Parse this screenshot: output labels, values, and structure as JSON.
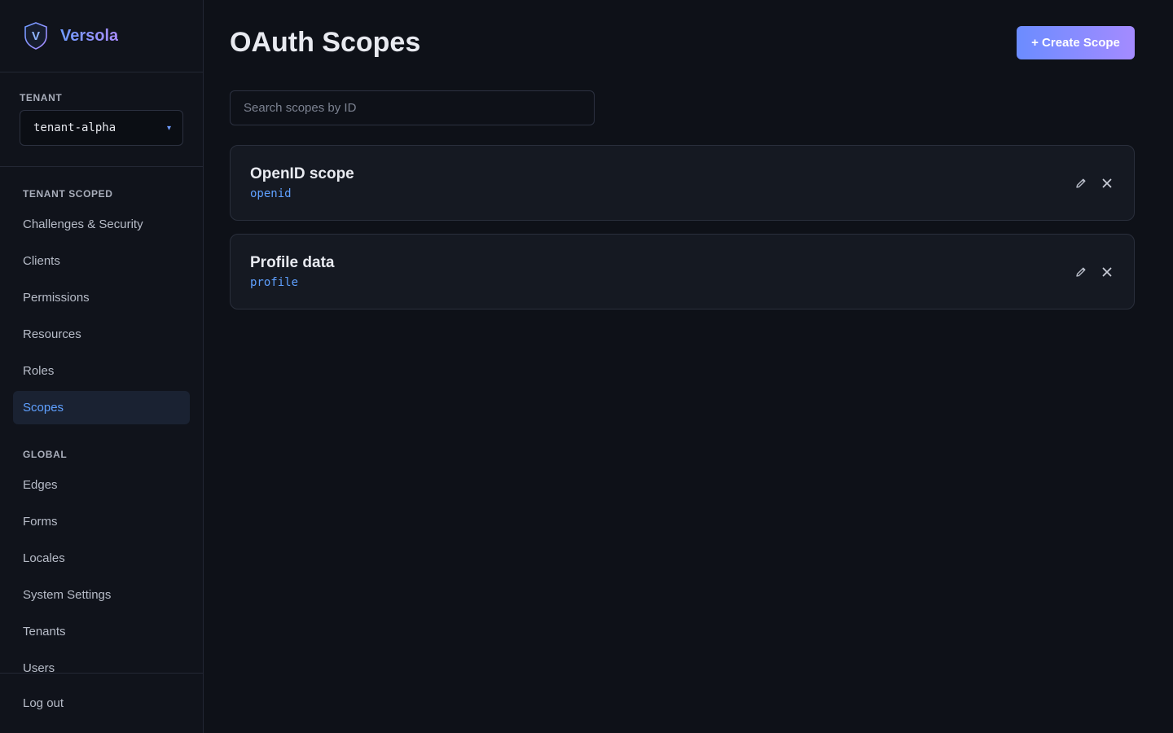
{
  "brand": {
    "name": "Versola",
    "logo_letter": "V"
  },
  "tenant": {
    "label": "TENANT",
    "selected": "tenant-alpha",
    "caret": "▾"
  },
  "nav": {
    "tenant_scoped_label": "TENANT SCOPED",
    "tenant_items": [
      {
        "label": "Challenges & Security"
      },
      {
        "label": "Clients"
      },
      {
        "label": "Permissions"
      },
      {
        "label": "Resources"
      },
      {
        "label": "Roles"
      },
      {
        "label": "Scopes",
        "active": true
      }
    ],
    "global_label": "GLOBAL",
    "global_items": [
      {
        "label": "Edges"
      },
      {
        "label": "Forms"
      },
      {
        "label": "Locales"
      },
      {
        "label": "System Settings"
      },
      {
        "label": "Tenants"
      },
      {
        "label": "Users"
      }
    ],
    "logout_label": "Log out"
  },
  "page": {
    "title": "OAuth Scopes",
    "create_label": "+ Create Scope",
    "search_placeholder": "Search scopes by ID"
  },
  "scopes": [
    {
      "title": "OpenID scope",
      "id": "openid"
    },
    {
      "title": "Profile data",
      "id": "profile"
    }
  ],
  "icons": {
    "edit": "edit-icon",
    "delete": "close-icon",
    "logo": "shield-icon"
  },
  "colors": {
    "accent": "#5fa0ff",
    "gradient_start": "#6b8cff",
    "gradient_end": "#a48bff",
    "background": "#0e1118"
  }
}
